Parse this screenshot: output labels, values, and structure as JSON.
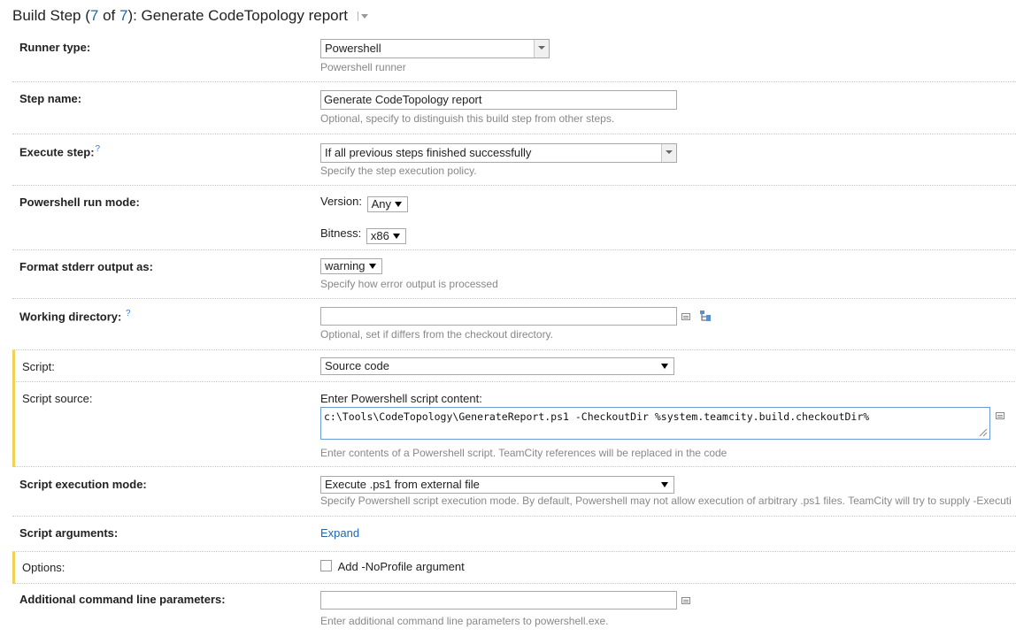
{
  "header": {
    "title_prefix": "Build Step (",
    "current": "7",
    "of": " of ",
    "total": "7",
    "title_suffix": "): Generate CodeTopology report"
  },
  "fields": {
    "runner_type": {
      "label": "Runner type:",
      "value": "Powershell",
      "hint": "Powershell runner"
    },
    "step_name": {
      "label": "Step name:",
      "value": "Generate CodeTopology report",
      "hint": "Optional, specify to distinguish this build step from other steps."
    },
    "execute_step": {
      "label": "Execute step:",
      "help": "?",
      "value": "If all previous steps finished successfully",
      "hint": "Specify the step execution policy."
    },
    "run_mode": {
      "label": "Powershell run mode:",
      "version_label": "Version:",
      "version_value": "Any",
      "bitness_label": "Bitness:",
      "bitness_value": "x86"
    },
    "stderr": {
      "label": "Format stderr output as:",
      "value": "warning",
      "hint": "Specify how error output is processed"
    },
    "working_dir": {
      "label": "Working directory:",
      "help": "?",
      "value": "",
      "hint": "Optional, set if differs from the checkout directory."
    },
    "script": {
      "label": "Script:",
      "value": "Source code"
    },
    "script_source": {
      "label": "Script source:",
      "prompt": "Enter Powershell script content:",
      "value": "c:\\Tools\\CodeTopology\\GenerateReport.ps1 -CheckoutDir %system.teamcity.build.checkoutDir%",
      "hint": "Enter contents of a Powershell script. TeamCity references will be replaced in the code"
    },
    "exec_mode": {
      "label": "Script execution mode:",
      "value": "Execute .ps1 from external file",
      "hint": "Specify Powershell script execution mode. By default, Powershell may not allow execution of arbitrary .ps1 files. TeamCity will try to supply -Executi"
    },
    "script_args": {
      "label": "Script arguments:",
      "link": "Expand"
    },
    "options": {
      "label": "Options:",
      "checkbox_label": "Add -NoProfile argument",
      "checked": false
    },
    "additional": {
      "label": "Additional command line parameters:",
      "value": "",
      "hint": "Enter additional command line parameters to powershell.exe."
    }
  },
  "colors": {
    "link": "#2367a8",
    "highlight_border": "#f2d250",
    "hint": "#888888"
  }
}
